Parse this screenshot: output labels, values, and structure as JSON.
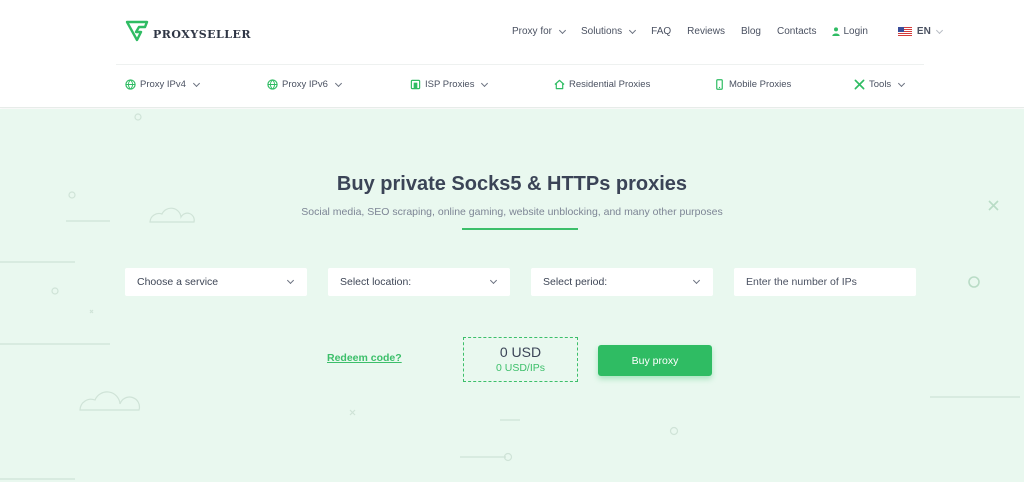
{
  "brand": {
    "name": "PROXYSELLER",
    "accent": "#2fbc63"
  },
  "topnav": {
    "items": [
      {
        "label": "Proxy for",
        "dropdown": true
      },
      {
        "label": "Solutions",
        "dropdown": true
      },
      {
        "label": "FAQ"
      },
      {
        "label": "Reviews"
      },
      {
        "label": "Blog"
      },
      {
        "label": "Contacts"
      }
    ],
    "login": "Login",
    "language": "EN"
  },
  "subnav": {
    "items": [
      {
        "label": "Proxy IPv4",
        "icon": "globe-icon",
        "dropdown": true
      },
      {
        "label": "Proxy IPv6",
        "icon": "globe-icon",
        "dropdown": true
      },
      {
        "label": "ISP Proxies",
        "icon": "building-icon",
        "dropdown": true
      },
      {
        "label": "Residential Proxies",
        "icon": "home-icon"
      },
      {
        "label": "Mobile Proxies",
        "icon": "phone-icon"
      },
      {
        "label": "Tools",
        "icon": "tools-icon",
        "dropdown": true
      }
    ]
  },
  "hero": {
    "title": "Buy private Socks5 & HTTPs proxies",
    "subtitle": "Social media, SEO scraping, online gaming, website unblocking, and many other purposes"
  },
  "form": {
    "service": "Choose a service",
    "location": "Select location:",
    "period": "Select period:",
    "ips_placeholder": "Enter the number of IPs"
  },
  "order": {
    "redeem": "Redeem code?",
    "total": "0 USD",
    "per_ip": "0 USD/IPs",
    "buy": "Buy proxy"
  }
}
